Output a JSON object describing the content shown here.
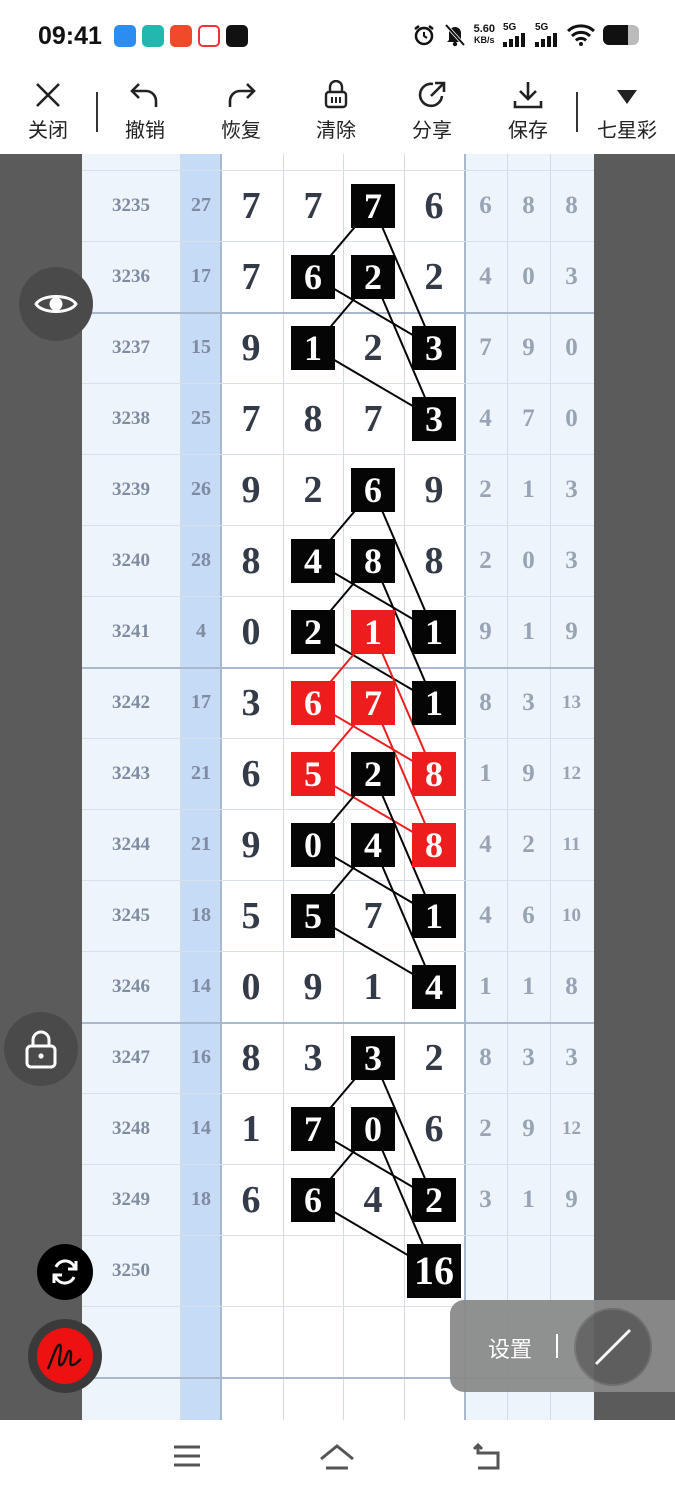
{
  "status_bar": {
    "time": "09:41",
    "net_speed_value": "5.60",
    "net_speed_unit": "KB/s",
    "signal_1": "5G",
    "signal_2": "5G",
    "battery_level": 0.7
  },
  "toolbar": {
    "close_label": "关闭",
    "undo_label": "撤销",
    "redo_label": "恢复",
    "clear_label": "清除",
    "share_label": "分享",
    "save_label": "保存",
    "lottery_label": "七星彩"
  },
  "rows": [
    {
      "period": "3235",
      "sum": "27",
      "digits": [
        "7",
        "7",
        "7",
        "6"
      ],
      "stats": [
        "6",
        "8",
        "8"
      ]
    },
    {
      "period": "3236",
      "sum": "17",
      "digits": [
        "7",
        "6",
        "2",
        "2"
      ],
      "stats": [
        "4",
        "0",
        "3"
      ]
    },
    {
      "period": "3237",
      "sum": "15",
      "digits": [
        "9",
        "1",
        "2",
        "3"
      ],
      "stats": [
        "7",
        "9",
        "0"
      ]
    },
    {
      "period": "3238",
      "sum": "25",
      "digits": [
        "7",
        "8",
        "7",
        "3"
      ],
      "stats": [
        "4",
        "7",
        "0"
      ]
    },
    {
      "period": "3239",
      "sum": "26",
      "digits": [
        "9",
        "2",
        "6",
        "9"
      ],
      "stats": [
        "2",
        "1",
        "3"
      ]
    },
    {
      "period": "3240",
      "sum": "28",
      "digits": [
        "8",
        "4",
        "8",
        "8"
      ],
      "stats": [
        "2",
        "0",
        "3"
      ]
    },
    {
      "period": "3241",
      "sum": "4",
      "digits": [
        "0",
        "2",
        "1",
        "1"
      ],
      "stats": [
        "9",
        "1",
        "9"
      ]
    },
    {
      "period": "3242",
      "sum": "17",
      "digits": [
        "3",
        "6",
        "7",
        "1"
      ],
      "stats": [
        "8",
        "3",
        "13"
      ]
    },
    {
      "period": "3243",
      "sum": "21",
      "digits": [
        "6",
        "5",
        "2",
        "8"
      ],
      "stats": [
        "1",
        "9",
        "12"
      ]
    },
    {
      "period": "3244",
      "sum": "21",
      "digits": [
        "9",
        "0",
        "4",
        "8"
      ],
      "stats": [
        "4",
        "2",
        "11"
      ]
    },
    {
      "period": "3245",
      "sum": "18",
      "digits": [
        "5",
        "5",
        "7",
        "1"
      ],
      "stats": [
        "4",
        "6",
        "10"
      ]
    },
    {
      "period": "3246",
      "sum": "14",
      "digits": [
        "0",
        "9",
        "1",
        "4"
      ],
      "stats": [
        "1",
        "1",
        "8"
      ]
    },
    {
      "period": "3247",
      "sum": "16",
      "digits": [
        "8",
        "3",
        "3",
        "2"
      ],
      "stats": [
        "8",
        "3",
        "3"
      ]
    },
    {
      "period": "3248",
      "sum": "14",
      "digits": [
        "1",
        "7",
        "0",
        "6"
      ],
      "stats": [
        "2",
        "9",
        "12"
      ]
    },
    {
      "period": "3249",
      "sum": "18",
      "digits": [
        "6",
        "6",
        "4",
        "2"
      ],
      "stats": [
        "3",
        "1",
        "9"
      ]
    },
    {
      "period": "3250",
      "sum": "",
      "digits": [
        "",
        "",
        "",
        "16"
      ],
      "stats": [
        "",
        "",
        ""
      ]
    },
    {
      "period": "",
      "sum": "",
      "digits": [
        "",
        "",
        "",
        ""
      ],
      "stats": [
        "",
        "",
        ""
      ]
    }
  ],
  "marks": [
    {
      "row": 0,
      "col": 2,
      "color": "black"
    },
    {
      "row": 1,
      "col": 1,
      "color": "black"
    },
    {
      "row": 1,
      "col": 2,
      "color": "black"
    },
    {
      "row": 2,
      "col": 1,
      "color": "black"
    },
    {
      "row": 2,
      "col": 3,
      "color": "black"
    },
    {
      "row": 3,
      "col": 3,
      "color": "black"
    },
    {
      "row": 4,
      "col": 2,
      "color": "black"
    },
    {
      "row": 5,
      "col": 1,
      "color": "black"
    },
    {
      "row": 5,
      "col": 2,
      "color": "black"
    },
    {
      "row": 6,
      "col": 1,
      "color": "black"
    },
    {
      "row": 6,
      "col": 2,
      "color": "red"
    },
    {
      "row": 6,
      "col": 3,
      "color": "black"
    },
    {
      "row": 7,
      "col": 1,
      "color": "red"
    },
    {
      "row": 7,
      "col": 2,
      "color": "red"
    },
    {
      "row": 7,
      "col": 3,
      "color": "black"
    },
    {
      "row": 8,
      "col": 1,
      "color": "red"
    },
    {
      "row": 8,
      "col": 2,
      "color": "black"
    },
    {
      "row": 8,
      "col": 3,
      "color": "red"
    },
    {
      "row": 9,
      "col": 1,
      "color": "black"
    },
    {
      "row": 9,
      "col": 2,
      "color": "black"
    },
    {
      "row": 9,
      "col": 3,
      "color": "red"
    },
    {
      "row": 10,
      "col": 1,
      "color": "black"
    },
    {
      "row": 10,
      "col": 3,
      "color": "black"
    },
    {
      "row": 11,
      "col": 3,
      "color": "black"
    },
    {
      "row": 12,
      "col": 2,
      "color": "black"
    },
    {
      "row": 13,
      "col": 1,
      "color": "black"
    },
    {
      "row": 13,
      "col": 2,
      "color": "black"
    },
    {
      "row": 14,
      "col": 1,
      "color": "black"
    },
    {
      "row": 14,
      "col": 3,
      "color": "black"
    },
    {
      "row": 15,
      "col": 3,
      "color": "black"
    }
  ],
  "connectors": [
    {
      "from": [
        0,
        2
      ],
      "to": [
        1,
        1
      ],
      "color": "black"
    },
    {
      "from": [
        0,
        2
      ],
      "to": [
        2,
        3
      ],
      "color": "black"
    },
    {
      "from": [
        1,
        1
      ],
      "to": [
        2,
        3
      ],
      "color": "black"
    },
    {
      "from": [
        1,
        2
      ],
      "to": [
        2,
        1
      ],
      "color": "black"
    },
    {
      "from": [
        1,
        2
      ],
      "to": [
        3,
        3
      ],
      "color": "black"
    },
    {
      "from": [
        2,
        1
      ],
      "to": [
        3,
        3
      ],
      "color": "black"
    },
    {
      "from": [
        4,
        2
      ],
      "to": [
        5,
        1
      ],
      "color": "black"
    },
    {
      "from": [
        4,
        2
      ],
      "to": [
        6,
        3
      ],
      "color": "black"
    },
    {
      "from": [
        5,
        1
      ],
      "to": [
        6,
        3
      ],
      "color": "black"
    },
    {
      "from": [
        5,
        2
      ],
      "to": [
        6,
        1
      ],
      "color": "black"
    },
    {
      "from": [
        5,
        2
      ],
      "to": [
        7,
        3
      ],
      "color": "black"
    },
    {
      "from": [
        6,
        1
      ],
      "to": [
        7,
        3
      ],
      "color": "black"
    },
    {
      "from": [
        6,
        2
      ],
      "to": [
        7,
        1
      ],
      "color": "red"
    },
    {
      "from": [
        6,
        2
      ],
      "to": [
        8,
        3
      ],
      "color": "red"
    },
    {
      "from": [
        7,
        1
      ],
      "to": [
        8,
        3
      ],
      "color": "red"
    },
    {
      "from": [
        7,
        2
      ],
      "to": [
        8,
        1
      ],
      "color": "red"
    },
    {
      "from": [
        7,
        2
      ],
      "to": [
        9,
        3
      ],
      "color": "red"
    },
    {
      "from": [
        8,
        1
      ],
      "to": [
        9,
        3
      ],
      "color": "red"
    },
    {
      "from": [
        8,
        2
      ],
      "to": [
        9,
        1
      ],
      "color": "black"
    },
    {
      "from": [
        8,
        2
      ],
      "to": [
        10,
        3
      ],
      "color": "black"
    },
    {
      "from": [
        9,
        1
      ],
      "to": [
        10,
        3
      ],
      "color": "black"
    },
    {
      "from": [
        9,
        2
      ],
      "to": [
        10,
        1
      ],
      "color": "black"
    },
    {
      "from": [
        9,
        2
      ],
      "to": [
        11,
        3
      ],
      "color": "black"
    },
    {
      "from": [
        10,
        1
      ],
      "to": [
        11,
        3
      ],
      "color": "black"
    },
    {
      "from": [
        12,
        2
      ],
      "to": [
        13,
        1
      ],
      "color": "black"
    },
    {
      "from": [
        12,
        2
      ],
      "to": [
        14,
        3
      ],
      "color": "black"
    },
    {
      "from": [
        13,
        1
      ],
      "to": [
        14,
        3
      ],
      "color": "black"
    },
    {
      "from": [
        13,
        2
      ],
      "to": [
        14,
        1
      ],
      "color": "black"
    },
    {
      "from": [
        13,
        2
      ],
      "to": [
        15,
        3
      ],
      "color": "black"
    },
    {
      "from": [
        14,
        1
      ],
      "to": [
        15,
        3
      ],
      "color": "black"
    }
  ],
  "floating_buttons": {
    "settings_label": "设置"
  },
  "colors": {
    "mark_black": "#050505",
    "mark_red": "#ee1d1d",
    "pen_red": "#ee1111"
  }
}
